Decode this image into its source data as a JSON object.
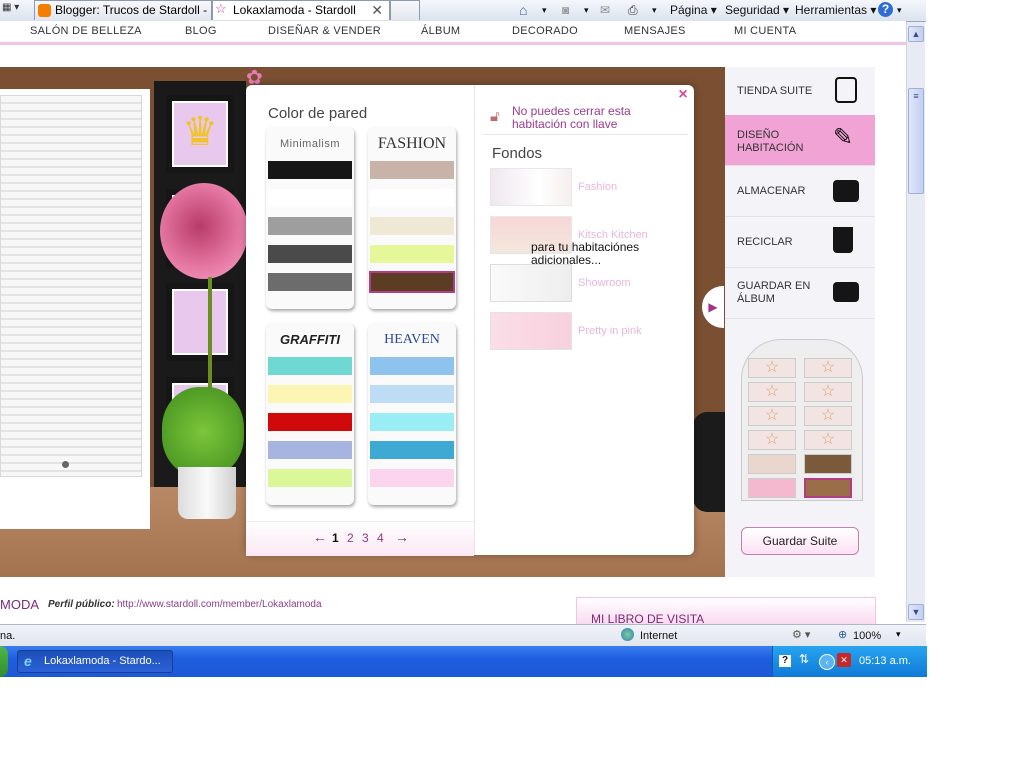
{
  "browser": {
    "tabs": [
      {
        "label": "Blogger: Trucos de Stardoll - ...",
        "active": false
      },
      {
        "label": "Lokaxlamoda - Stardoll",
        "active": true
      }
    ],
    "toolbar": {
      "page_label": "Página",
      "security_label": "Seguridad",
      "tools_label": "Herramientas",
      "help_label": "?"
    }
  },
  "site_nav": {
    "items": [
      "SALÓN DE BELLEZA",
      "BLOG",
      "DISEÑAR & VENDER",
      "ÁLBUM",
      "DECORADO",
      "MENSAJES",
      "MI CUENTA"
    ]
  },
  "popup": {
    "close_glyph": "×",
    "wall_title": "Color de pared",
    "swatches": [
      {
        "name": "Minimalism",
        "colors": [
          "#161616",
          "#ffffff",
          "#9e9e9e",
          "#4a4a4a",
          "#6c6c6c"
        ]
      },
      {
        "name": "FASHION",
        "colors": [
          "#c9b3a8",
          "#ffffff",
          "#eee8d5",
          "#e6f79a",
          "#5a3d23"
        ]
      },
      {
        "name": "GRAFFITI",
        "colors": [
          "#6fd8d2",
          "#fcf5b4",
          "#d00a0a",
          "#a8b4e0",
          "#dcf79a"
        ]
      },
      {
        "name": "HEAVEN",
        "colors": [
          "#8ec3ee",
          "#bfdcf5",
          "#9bedf5",
          "#3eaad3",
          "#fbd4ee"
        ]
      }
    ],
    "pagination": {
      "prev": "←",
      "pages": [
        "1",
        "2",
        "3",
        "4"
      ],
      "current": "1",
      "next": "→"
    },
    "lock_message": "No puedes cerrar esta habitación con llave",
    "fondos_title": "Fondos",
    "fondos": [
      "Fashion",
      "Kitsch Kitchen",
      "Showroom",
      "Pretty in pink"
    ],
    "tooltip": "para tu habitaciónes adicionales..."
  },
  "side_menu": {
    "items": [
      {
        "label": "TIENDA SUITE",
        "icon": "shopping-bag-icon"
      },
      {
        "label": "DISEÑO HABITACIÓN",
        "icon": "brush-icon"
      },
      {
        "label": "ALMACENAR",
        "icon": "drawer-icon"
      },
      {
        "label": "RECICLAR",
        "icon": "recycle-bin-icon"
      },
      {
        "label": "GUARDAR EN ÁLBUM",
        "icon": "camera-icon"
      }
    ],
    "save_suite": "Guardar Suite"
  },
  "profile": {
    "name_fragment": "MODA",
    "public_label": "Perfil público:",
    "public_url": "http://www.stardoll.com/member/Lokaxlamoda",
    "guestbook": "MI LIBRO DE VISITA"
  },
  "statusbar": {
    "left_text": "na.",
    "zone": "Internet",
    "zoom": "100%"
  },
  "taskbar": {
    "window_label": "Lokaxlamoda - Stardo...",
    "clock": "05:13 a.m."
  }
}
